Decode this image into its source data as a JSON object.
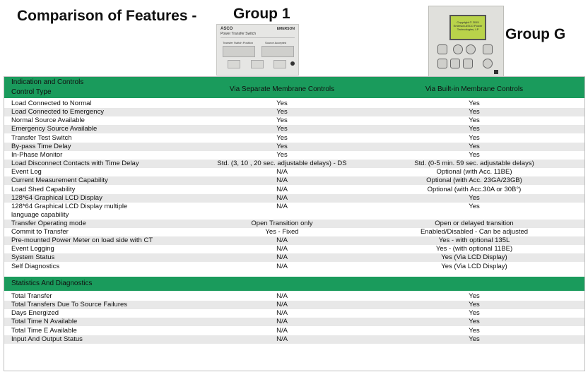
{
  "header": {
    "title": "Comparison of Features -",
    "group1": "Group 1",
    "groupG": "Group G"
  },
  "device1": {
    "brand": "ASCO",
    "brand2": "EMERSON",
    "subtitle": "Power Transfer Switch",
    "label_left": "Transfer Switch Position",
    "label_right": "Source Accepted",
    "box_left": "Normal Emergency",
    "box_right": "Normal Emergency"
  },
  "deviceG": {
    "lcd_text": "Copyright © 2015 Emerson ASCO Power Technologies, LP"
  },
  "section1": {
    "title_line1": "Indication and Controls",
    "title_line2": "Control Type",
    "col2": "Via Separate Membrane Controls",
    "col3": "Via Built-in Membrane Controls"
  },
  "rows1": [
    {
      "f": "Load Connected to Normal",
      "a": "Yes",
      "b": "Yes"
    },
    {
      "f": "Load Connected to Emergency",
      "a": "Yes",
      "b": "Yes"
    },
    {
      "f": "Normal Source Available",
      "a": "Yes",
      "b": "Yes"
    },
    {
      "f": "Emergency Source Available",
      "a": "Yes",
      "b": "Yes"
    },
    {
      "f": "Transfer Test Switch",
      "a": "Yes",
      "b": "Yes"
    },
    {
      "f": "By-pass Time Delay",
      "a": "Yes",
      "b": "Yes"
    },
    {
      "f": "In-Phase Monitor",
      "a": "Yes",
      "b": "Yes"
    },
    {
      "f": "Load Disconnect Contacts with Time Delay",
      "a": "Std. (3, 10 , 20 sec. adjustable delays) - DS",
      "b": "Std. (0-5 min. 59 sec. adjustable delays)"
    },
    {
      "f": "Event Log",
      "a": "N/A",
      "b": "Optional (with Acc. 11BE)"
    },
    {
      "f": "Current Measurement Capability",
      "a": "N/A",
      "b": "Optional (with Acc. 23GA/23GB)"
    },
    {
      "f": "Load Shed Capability",
      "a": "N/A",
      "b": "Optional (with Acc.30A or 30B°)"
    },
    {
      "f": "128*64 Graphical LCD Display",
      "a": "N/A",
      "b": "Yes"
    },
    {
      "f": "128*64 Graphical LCD Display multiple",
      "f2": "language capability",
      "a": "N/A",
      "b": "Yes"
    },
    {
      "f": "Transfer Operating mode",
      "a": "Open Transition only",
      "b": "Open or delayed transition"
    },
    {
      "f": "Commit to Transfer",
      "a": "Yes - Fixed",
      "b": "Enabled/Disabled - Can be adjusted"
    },
    {
      "f": "Pre-mounted Power Meter on load side with CT",
      "a": "N/A",
      "b": "Yes - with optional 135L"
    },
    {
      "f": "Event Logging",
      "a": "N/A",
      "b": "Yes - (with optional 11BE)"
    },
    {
      "f": "System Status",
      "a": "N/A",
      "b": "Yes (Via LCD Display)"
    },
    {
      "f": "Self Diagnostics",
      "a": "N/A",
      "b": "Yes (Via LCD Display)"
    }
  ],
  "section2": {
    "title": "Statistics And Diagnostics"
  },
  "rows2": [
    {
      "f": "Total Transfer",
      "a": "N/A",
      "b": "Yes"
    },
    {
      "f": "Total Transfers Due To Source Failures",
      "a": "N/A",
      "b": "Yes"
    },
    {
      "f": "Days Energized",
      "a": "N/A",
      "b": "Yes"
    },
    {
      "f": "Total Time N Available",
      "a": "N/A",
      "b": "Yes"
    },
    {
      "f": "Total Time E Available",
      "a": "N/A",
      "b": "Yes"
    },
    {
      "f": "Input And Output Status",
      "a": "N/A",
      "b": "Yes"
    }
  ]
}
